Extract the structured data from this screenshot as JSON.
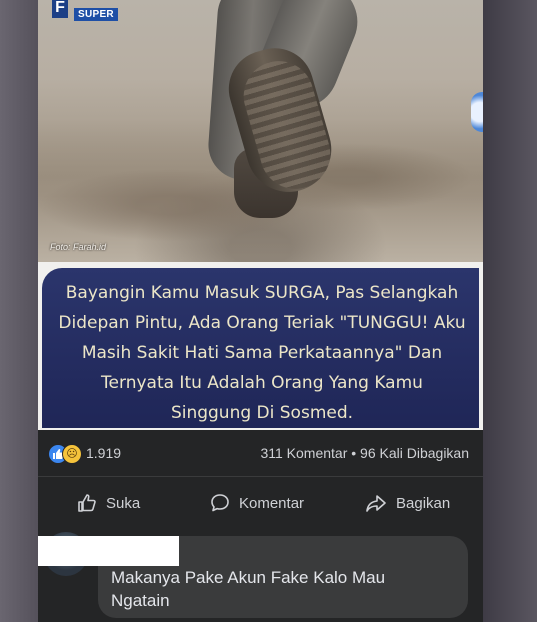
{
  "post": {
    "logo_letter": "F",
    "logo_label": "SUPER",
    "photo_credit": "Foto: Farah.id",
    "quote_lines": [
      "Bayangin Kamu Masuk SURGA, Pas Selangkah",
      "Didepan Pintu, Ada Orang Teriak \"TUNGGU! Aku",
      "Masih Sakit Hati Sama Perkataannya\" Dan",
      "Ternyata Itu Adalah Orang Yang Kamu",
      "Singgung Di Sosmed."
    ]
  },
  "stats": {
    "reaction_count": "1.919",
    "comments_shares": "311 Komentar • 96 Kali Dibagikan",
    "reactions": [
      "like-icon",
      "sad-icon"
    ]
  },
  "actions": {
    "like_label": "Suka",
    "comment_label": "Komentar",
    "share_label": "Bagikan"
  },
  "comment": {
    "text_line1": "Makanya Pake Akun Fake Kalo Mau",
    "text_line2": "Ngatain"
  },
  "colors": {
    "card_bg": "#242526",
    "quote_bg": "#1f2657",
    "quote_text": "#ece6c8",
    "like_blue": "#3b86ef",
    "bubble": "#3a3b3c"
  }
}
